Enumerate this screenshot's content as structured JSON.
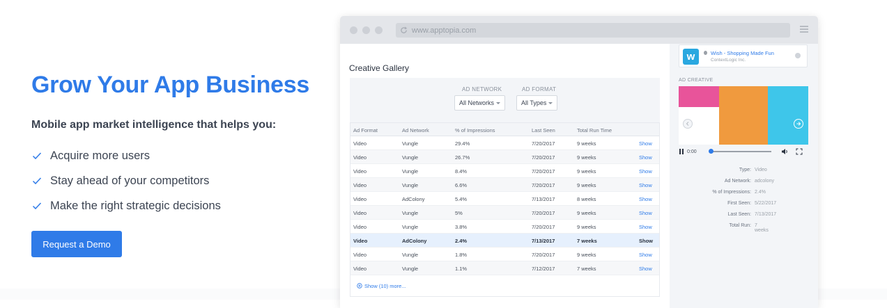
{
  "hero": {
    "title": "Grow Your App Business",
    "subtitle": "Mobile app market intelligence that helps you:",
    "bullets": [
      "Acquire more users",
      "Stay ahead of your competitors",
      "Make the right strategic decisions"
    ],
    "cta_label": "Request a Demo"
  },
  "browser": {
    "url": "www.apptopia.com"
  },
  "gallery": {
    "title": "Creative Gallery",
    "filters": {
      "network_label": "AD NETWORK",
      "network_value": "All Networks",
      "format_label": "AD FORMAT",
      "format_value": "All Types"
    },
    "columns": [
      "Ad Format",
      "Ad Network",
      "% of Impressions",
      "Last Seen",
      "Total Run Time"
    ],
    "rows": [
      {
        "format": "Video",
        "network": "Vungle",
        "impressions": "29.4%",
        "last_seen": "7/20/2017",
        "run_time": "9 weeks",
        "action": "Show"
      },
      {
        "format": "Video",
        "network": "Vungle",
        "impressions": "26.7%",
        "last_seen": "7/20/2017",
        "run_time": "9 weeks",
        "action": "Show"
      },
      {
        "format": "Video",
        "network": "Vungle",
        "impressions": "8.4%",
        "last_seen": "7/20/2017",
        "run_time": "9 weeks",
        "action": "Show"
      },
      {
        "format": "Video",
        "network": "Vungle",
        "impressions": "6.6%",
        "last_seen": "7/20/2017",
        "run_time": "9 weeks",
        "action": "Show"
      },
      {
        "format": "Video",
        "network": "AdColony",
        "impressions": "5.4%",
        "last_seen": "7/13/2017",
        "run_time": "8 weeks",
        "action": "Show"
      },
      {
        "format": "Video",
        "network": "Vungle",
        "impressions": "5%",
        "last_seen": "7/20/2017",
        "run_time": "9 weeks",
        "action": "Show"
      },
      {
        "format": "Video",
        "network": "Vungle",
        "impressions": "3.8%",
        "last_seen": "7/20/2017",
        "run_time": "9 weeks",
        "action": "Show"
      },
      {
        "format": "Video",
        "network": "AdColony",
        "impressions": "2.4%",
        "last_seen": "7/13/2017",
        "run_time": "7 weeks",
        "action": "Show"
      },
      {
        "format": "Video",
        "network": "Vungle",
        "impressions": "1.8%",
        "last_seen": "7/20/2017",
        "run_time": "9 weeks",
        "action": "Show"
      },
      {
        "format": "Video",
        "network": "Vungle",
        "impressions": "1.1%",
        "last_seen": "7/12/2017",
        "run_time": "7 weeks",
        "action": "Show"
      }
    ],
    "selected_row": 7,
    "show_more": "Show (10) more..."
  },
  "panel": {
    "app_name": "Wish - Shopping Made Fun",
    "app_developer": "ContextLogic Inc.",
    "app_logo_letter": "w",
    "ad_creative_label": "AD CREATIVE",
    "player_time": "0:00",
    "details": [
      {
        "key": "Type:",
        "value": "Video"
      },
      {
        "key": "Ad Network:",
        "value": "adcolony"
      },
      {
        "key": "% of Impressions:",
        "value": "2.4%"
      },
      {
        "key": "First Seen:",
        "value": "5/22/2017"
      },
      {
        "key": "Last Seen:",
        "value": "7/13/2017"
      },
      {
        "key": "Total Run:",
        "value": "7 weeks"
      }
    ],
    "creative_colors": [
      "#e8549a",
      "#f09a3e",
      "#3ec6ea"
    ]
  },
  "colors": {
    "accent": "#2f7be8",
    "text": "#3c4452"
  }
}
